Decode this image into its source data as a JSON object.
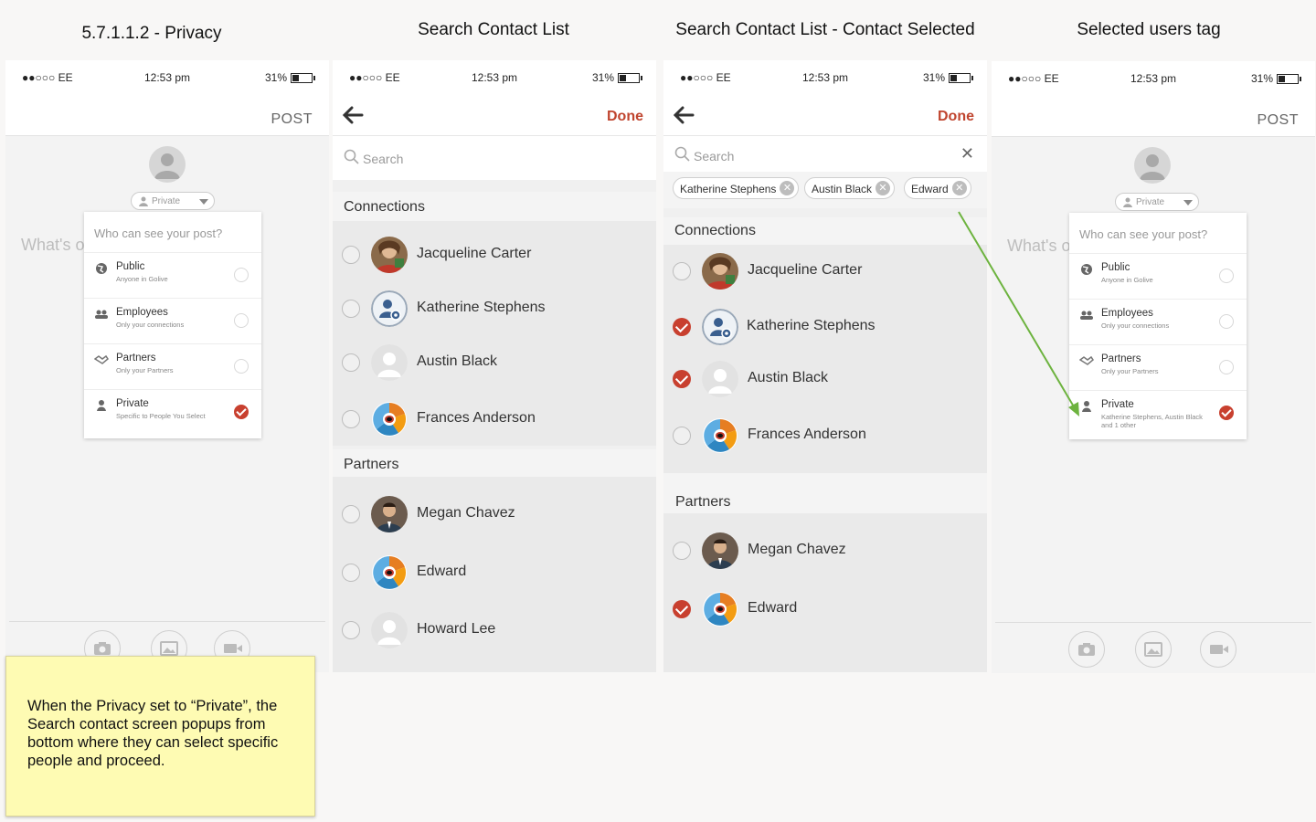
{
  "titles": {
    "s1": "5.7.1.1.2 - Privacy",
    "s2": "Search Contact List",
    "s3": "Search Contact List - Contact Selected",
    "s4": "Selected users tag"
  },
  "status": {
    "signal": "●●○○○ EE",
    "time": "12:53 pm",
    "battery": "31%"
  },
  "compose": {
    "post_label": "POST",
    "privacy_pill": "Private",
    "placeholder": "What's o",
    "menu_title": "Who can see your post?",
    "options": [
      {
        "label": "Public",
        "sub": "Anyone in Golive"
      },
      {
        "label": "Employees",
        "sub": "Only your connections"
      },
      {
        "label": "Partners",
        "sub": "Only your Partners"
      },
      {
        "label": "Private",
        "sub": "Specific to People You Select"
      }
    ],
    "private_selected_sub": "Katherine Stephens, Austin Black and 1 other"
  },
  "search": {
    "done_label": "Done",
    "placeholder": "Search",
    "chips": [
      "Katherine Stephens",
      "Austin Black",
      "Edward"
    ],
    "connections_label": "Connections",
    "partners_label": "Partners",
    "connections": [
      "Jacqueline Carter",
      "Katherine Stephens",
      "Austin Black",
      "Frances Anderson"
    ],
    "partners": [
      "Megan Chavez",
      "Edward",
      "Howard Lee"
    ]
  },
  "note": "When the Privacy set to “Private”, the Search contact screen popups from bottom where they can select specific people and proceed.",
  "colors": {
    "accent": "#c8402f",
    "arrow": "#6db33f",
    "note_bg": "#fefbb3"
  }
}
